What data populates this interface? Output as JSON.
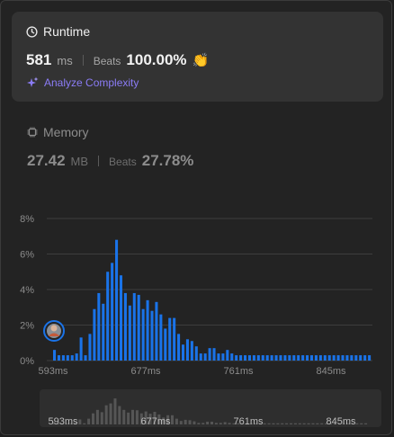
{
  "runtime": {
    "title": "Runtime",
    "value": "581",
    "unit": "ms",
    "beats_label": "Beats",
    "beats_value": "100.00%",
    "clap_icon": "👏",
    "analyze_label": "Analyze Complexity"
  },
  "memory": {
    "title": "Memory",
    "value": "27.42",
    "unit": "MB",
    "beats_label": "Beats",
    "beats_value": "27.78%"
  },
  "colors": {
    "accent_bar": "#1a73e8",
    "analyze": "#8b7cf6",
    "clap": "#2db55d"
  },
  "chart_data": {
    "type": "bar",
    "ylim": [
      0,
      8
    ],
    "y_ticks": [
      "0%",
      "2%",
      "4%",
      "6%",
      "8%"
    ],
    "x_ticks": [
      "593ms",
      "677ms",
      "761ms",
      "845ms"
    ],
    "user_marker_value": "581",
    "values": [
      0.6,
      0.3,
      0.3,
      0.3,
      0.3,
      0.4,
      1.3,
      0.3,
      1.5,
      2.9,
      3.8,
      3.2,
      5.0,
      5.5,
      6.8,
      4.8,
      3.8,
      3.1,
      3.8,
      3.7,
      2.9,
      3.4,
      2.8,
      3.3,
      2.6,
      1.8,
      2.4,
      2.4,
      1.5,
      0.9,
      1.2,
      1.1,
      0.8,
      0.4,
      0.4,
      0.7,
      0.7,
      0.4,
      0.4,
      0.6,
      0.4,
      0.3,
      0.3,
      0.3,
      0.3,
      0.3,
      0.3,
      0.3,
      0.3,
      0.3,
      0.3,
      0.3,
      0.3,
      0.3,
      0.3,
      0.3,
      0.3,
      0.3,
      0.3,
      0.3,
      0.3,
      0.3,
      0.3,
      0.3,
      0.3,
      0.3,
      0.3,
      0.3,
      0.3,
      0.3,
      0.3,
      0.3
    ]
  }
}
